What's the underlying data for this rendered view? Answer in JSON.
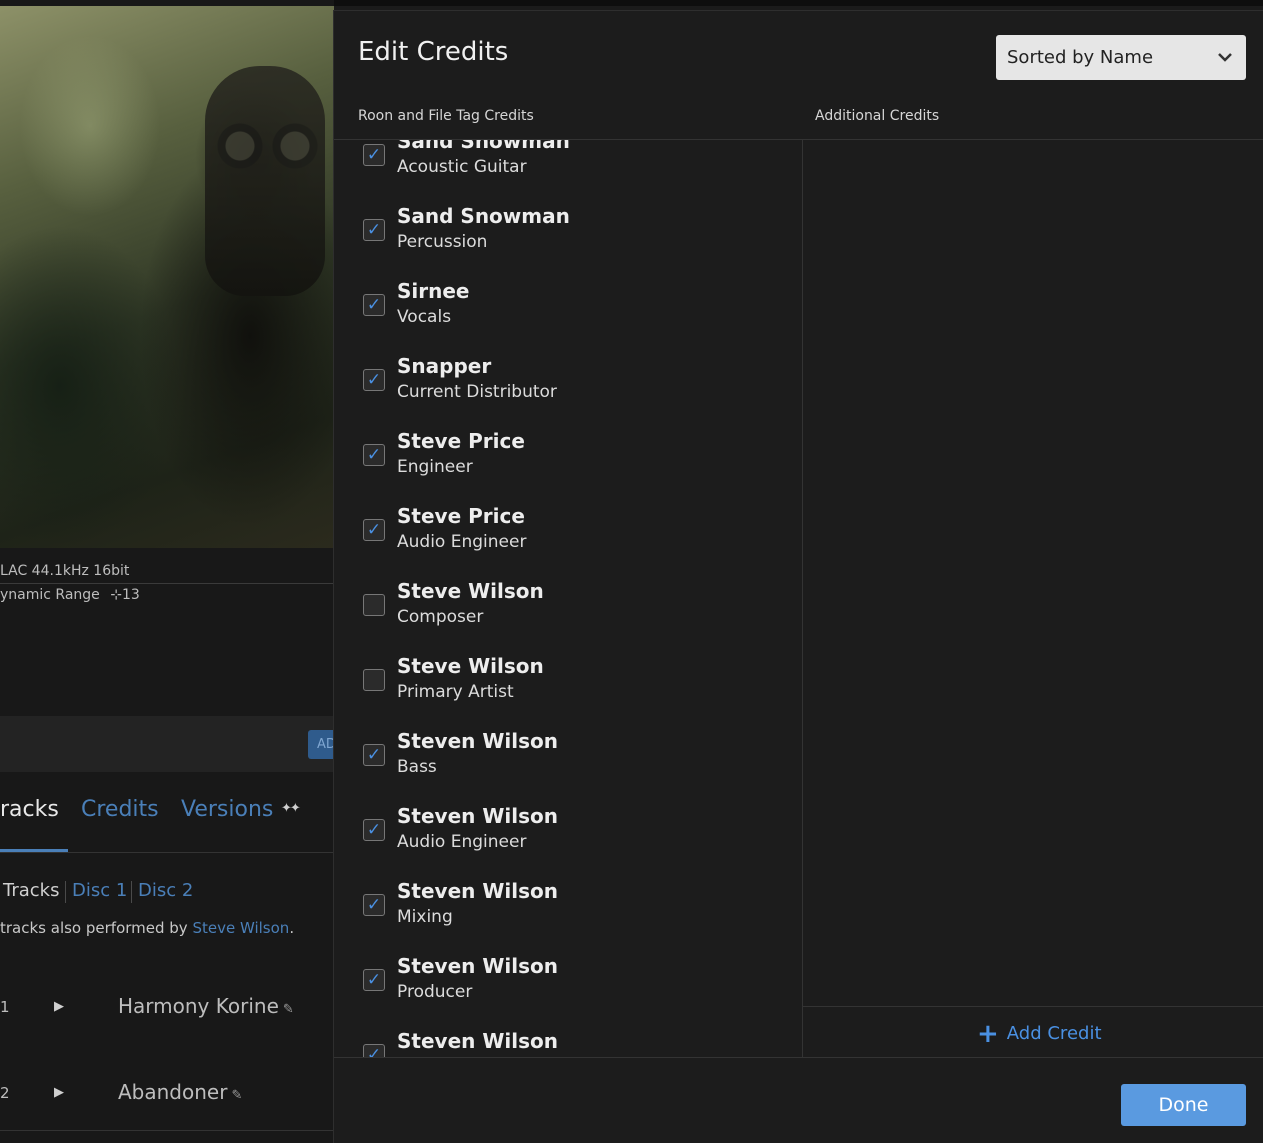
{
  "background": {
    "format": "LAC 44.1kHz 16bit",
    "dynamic_range": "ynamic Range",
    "dynamic_range_value": "13",
    "add_button": "AD",
    "tabs": [
      "racks",
      "Credits",
      "Versions"
    ],
    "discs": [
      "Tracks",
      "Disc 1",
      "Disc 2"
    ],
    "performed_text": "tracks also performed by",
    "performed_artist": "Steve Wilson",
    "performed_end": ".",
    "tracks": [
      {
        "num": "1",
        "title": "Harmony Korine"
      },
      {
        "num": "2",
        "title": "Abandoner"
      }
    ]
  },
  "dialog": {
    "title": "Edit Credits",
    "sort": {
      "selected": "Sorted by Name"
    },
    "left_header": "Roon and File Tag Credits",
    "right_header": "Additional Credits",
    "credits": [
      {
        "name": "Sand Snowman",
        "role": "Acoustic Guitar",
        "checked": true
      },
      {
        "name": "Sand Snowman",
        "role": "Percussion",
        "checked": true
      },
      {
        "name": "Sirnee",
        "role": "Vocals",
        "checked": true
      },
      {
        "name": "Snapper",
        "role": "Current Distributor",
        "checked": true
      },
      {
        "name": "Steve Price",
        "role": "Engineer",
        "checked": true
      },
      {
        "name": "Steve Price",
        "role": "Audio Engineer",
        "checked": true
      },
      {
        "name": "Steve Wilson",
        "role": "Composer",
        "checked": false
      },
      {
        "name": "Steve Wilson",
        "role": "Primary Artist",
        "checked": false
      },
      {
        "name": "Steven Wilson",
        "role": "Bass",
        "checked": true
      },
      {
        "name": "Steven Wilson",
        "role": "Audio Engineer",
        "checked": true
      },
      {
        "name": "Steven Wilson",
        "role": "Mixing",
        "checked": true
      },
      {
        "name": "Steven Wilson",
        "role": "Producer",
        "checked": true
      },
      {
        "name": "Steven Wilson",
        "role": "",
        "checked": true
      }
    ],
    "add_credit": "Add Credit",
    "done": "Done"
  },
  "icons": {
    "check": "checkmark-icon",
    "chevron": "chevron-down-icon",
    "plus": "plus-icon",
    "play": "play-icon",
    "edit": "pencil-icon"
  },
  "colors": {
    "accent": "#4a90e2",
    "done_button": "#5a9ae0",
    "dialog_bg": "#1c1c1c"
  }
}
